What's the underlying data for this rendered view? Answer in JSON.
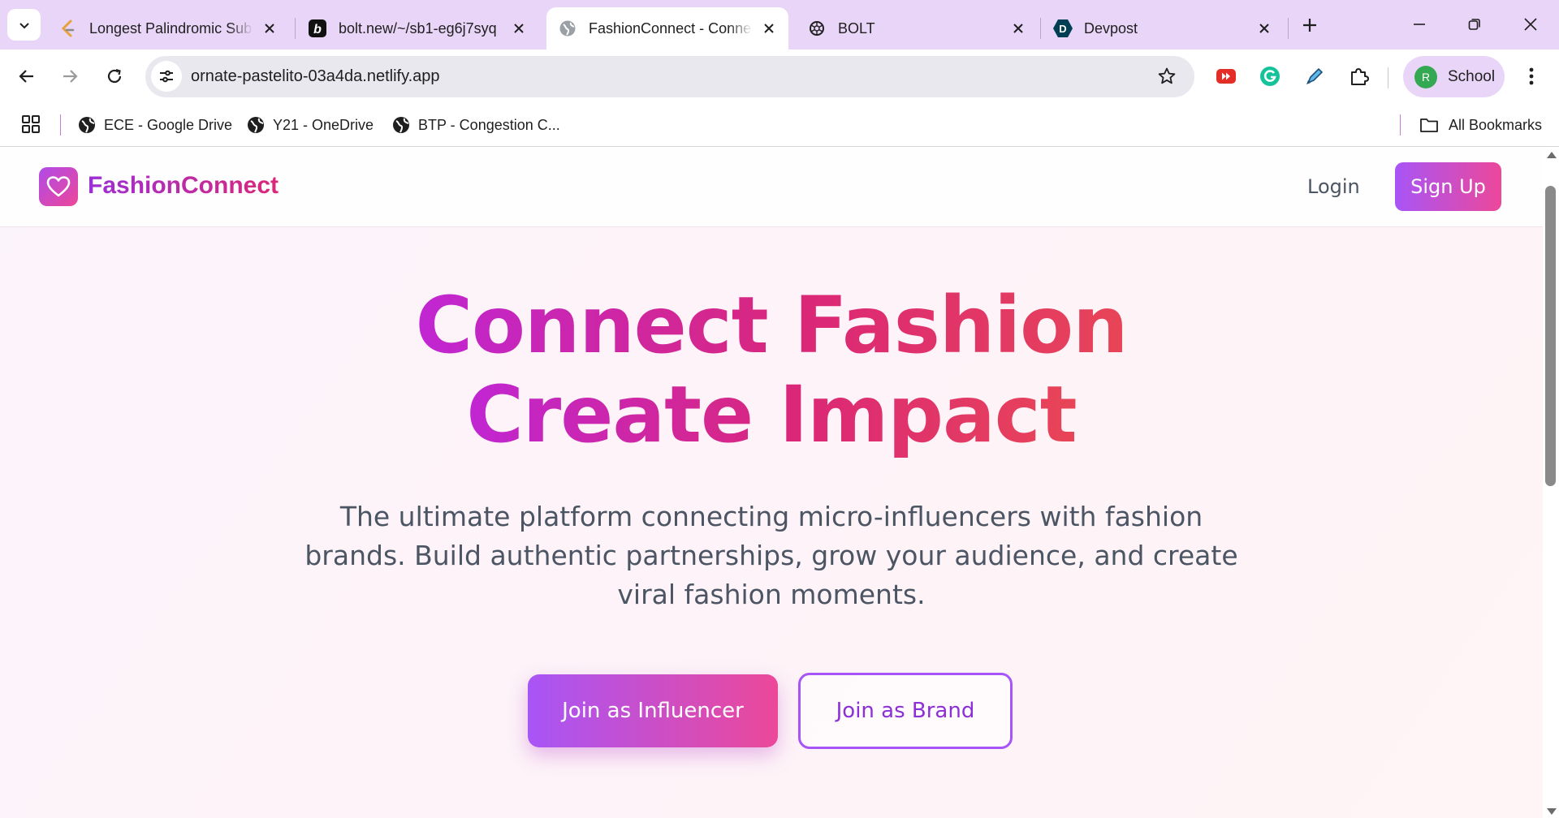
{
  "browser": {
    "tabs": [
      {
        "title": "Longest Palindromic Sub",
        "favicon": "leetcode-icon"
      },
      {
        "title": "bolt.new/~/sb1-eg6j7syq",
        "favicon": "bolt-icon"
      },
      {
        "title": "FashionConnect - Conne",
        "favicon": "globe-icon",
        "active": true
      },
      {
        "title": "BOLT",
        "favicon": "openai-icon"
      },
      {
        "title": "Devpost",
        "favicon": "devpost-icon"
      }
    ],
    "url": "ornate-pastelito-03a4da.netlify.app",
    "profile": {
      "initial": "R",
      "label": "School"
    },
    "bookmarks": [
      {
        "label": "ECE - Google Drive"
      },
      {
        "label": "Y21 - OneDrive"
      },
      {
        "label": "BTP - Congestion C..."
      }
    ],
    "all_bookmarks": "All Bookmarks"
  },
  "site": {
    "brand": "FashionConnect",
    "nav": {
      "login": "Login",
      "signup": "Sign Up"
    },
    "hero": {
      "title_line1": "Connect Fashion",
      "title_line2": "Create Impact",
      "subtitle": "The ultimate platform connecting micro-influencers with fashion brands. Build authentic partnerships, grow your audience, and create viral fashion moments.",
      "cta_influencer": "Join as Influencer",
      "cta_brand": "Join as Brand"
    }
  },
  "colors": {
    "tabstrip": "#e9d5f8",
    "brand_purple": "#a855f7",
    "brand_pink": "#ec4899",
    "hero_magenta": "#c026d3"
  }
}
